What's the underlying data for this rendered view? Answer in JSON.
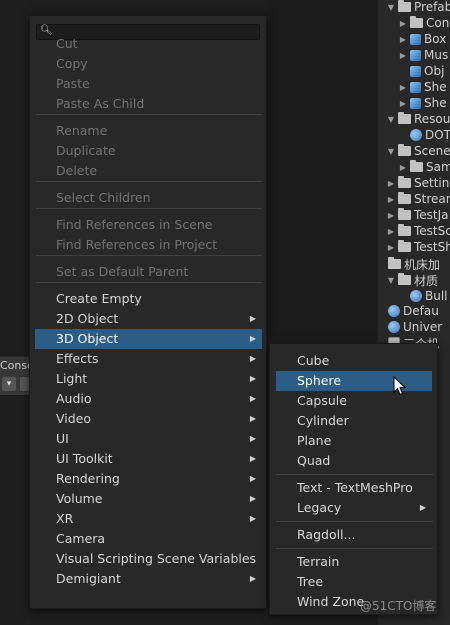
{
  "console": {
    "tab_label": "Console"
  },
  "search": {
    "placeholder": "",
    "value": ""
  },
  "menu": {
    "items": [
      {
        "label": "Cut",
        "disabled": true
      },
      {
        "label": "Copy",
        "disabled": true
      },
      {
        "label": "Paste",
        "disabled": true
      },
      {
        "label": "Paste As Child",
        "disabled": true
      },
      {
        "label": "Rename",
        "disabled": true
      },
      {
        "label": "Duplicate",
        "disabled": true
      },
      {
        "label": "Delete",
        "disabled": true
      },
      {
        "label": "Select Children",
        "disabled": true
      },
      {
        "label": "Find References in Scene",
        "disabled": true
      },
      {
        "label": "Find References in Project",
        "disabled": true
      },
      {
        "label": "Set as Default Parent",
        "disabled": true
      },
      {
        "label": "Create Empty",
        "disabled": false
      },
      {
        "label": "2D Object",
        "disabled": false,
        "submenu": true
      },
      {
        "label": "3D Object",
        "disabled": false,
        "submenu": true,
        "selected": true
      },
      {
        "label": "Effects",
        "disabled": false,
        "submenu": true
      },
      {
        "label": "Light",
        "disabled": false,
        "submenu": true
      },
      {
        "label": "Audio",
        "disabled": false,
        "submenu": true
      },
      {
        "label": "Video",
        "disabled": false,
        "submenu": true
      },
      {
        "label": "UI",
        "disabled": false,
        "submenu": true
      },
      {
        "label": "UI Toolkit",
        "disabled": false,
        "submenu": true
      },
      {
        "label": "Rendering",
        "disabled": false,
        "submenu": true
      },
      {
        "label": "Volume",
        "disabled": false,
        "submenu": true
      },
      {
        "label": "XR",
        "disabled": false,
        "submenu": true
      },
      {
        "label": "Camera",
        "disabled": false
      },
      {
        "label": "Visual Scripting Scene Variables",
        "disabled": false
      },
      {
        "label": "Demigiant",
        "disabled": false,
        "submenu": true
      }
    ]
  },
  "submenu_3d": {
    "items": [
      {
        "label": "Cube"
      },
      {
        "label": "Sphere",
        "selected": true
      },
      {
        "label": "Capsule"
      },
      {
        "label": "Cylinder"
      },
      {
        "label": "Plane"
      },
      {
        "label": "Quad"
      },
      {
        "label": "Text - TextMeshPro"
      },
      {
        "label": "Legacy",
        "submenu": true
      },
      {
        "label": "Ragdoll..."
      },
      {
        "label": "Terrain"
      },
      {
        "label": "Tree"
      },
      {
        "label": "Wind Zone"
      }
    ]
  },
  "project_tree": {
    "rows": [
      {
        "label": "Prefab",
        "icon": "folder-icon",
        "arrow": "▼"
      },
      {
        "label": "Con",
        "icon": "folder-icon",
        "arrow": "▶"
      },
      {
        "label": "Box",
        "icon": "prefab-icon",
        "arrow": "▶"
      },
      {
        "label": "Mus",
        "icon": "prefab-icon",
        "arrow": "▶"
      },
      {
        "label": "Obj",
        "icon": "prefab-icon",
        "arrow": ""
      },
      {
        "label": "She",
        "icon": "prefab-icon",
        "arrow": "▶"
      },
      {
        "label": "She",
        "icon": "prefab-icon",
        "arrow": "▶"
      },
      {
        "label": "Resou",
        "icon": "folder-icon",
        "arrow": "▼"
      },
      {
        "label": "DOT",
        "icon": "asset-icon",
        "arrow": ""
      },
      {
        "label": "Scene",
        "icon": "folder-icon",
        "arrow": "▼"
      },
      {
        "label": "Sam",
        "icon": "folder-icon",
        "arrow": "▶"
      },
      {
        "label": "Settin",
        "icon": "folder-icon",
        "arrow": "▶"
      },
      {
        "label": "Strean",
        "icon": "folder-icon",
        "arrow": "▶"
      },
      {
        "label": "TestJa",
        "icon": "folder-icon",
        "arrow": "▶"
      },
      {
        "label": "TestSc",
        "icon": "folder-icon",
        "arrow": "▶"
      },
      {
        "label": "TestSh",
        "icon": "folder-icon",
        "arrow": "▶"
      },
      {
        "label": "机床加",
        "icon": "folder-icon",
        "arrow": ""
      },
      {
        "label": "材质",
        "icon": "folder-icon",
        "arrow": "▼"
      },
      {
        "label": "Bull",
        "icon": "material-icon",
        "arrow": ""
      },
      {
        "label": "Defau",
        "icon": "asset-icon",
        "arrow": ""
      },
      {
        "label": "Univer",
        "icon": "asset-icon",
        "arrow": ""
      },
      {
        "label": "三个机",
        "icon": "scene-icon",
        "arrow": ""
      },
      {
        "label": "ag",
        "icon": "",
        "arrow": ""
      }
    ]
  },
  "watermark": "@51CTO博客",
  "colors": {
    "menu_bg": "#282828",
    "selected_bg": "#2c5d87",
    "disabled_text": "#737373"
  }
}
